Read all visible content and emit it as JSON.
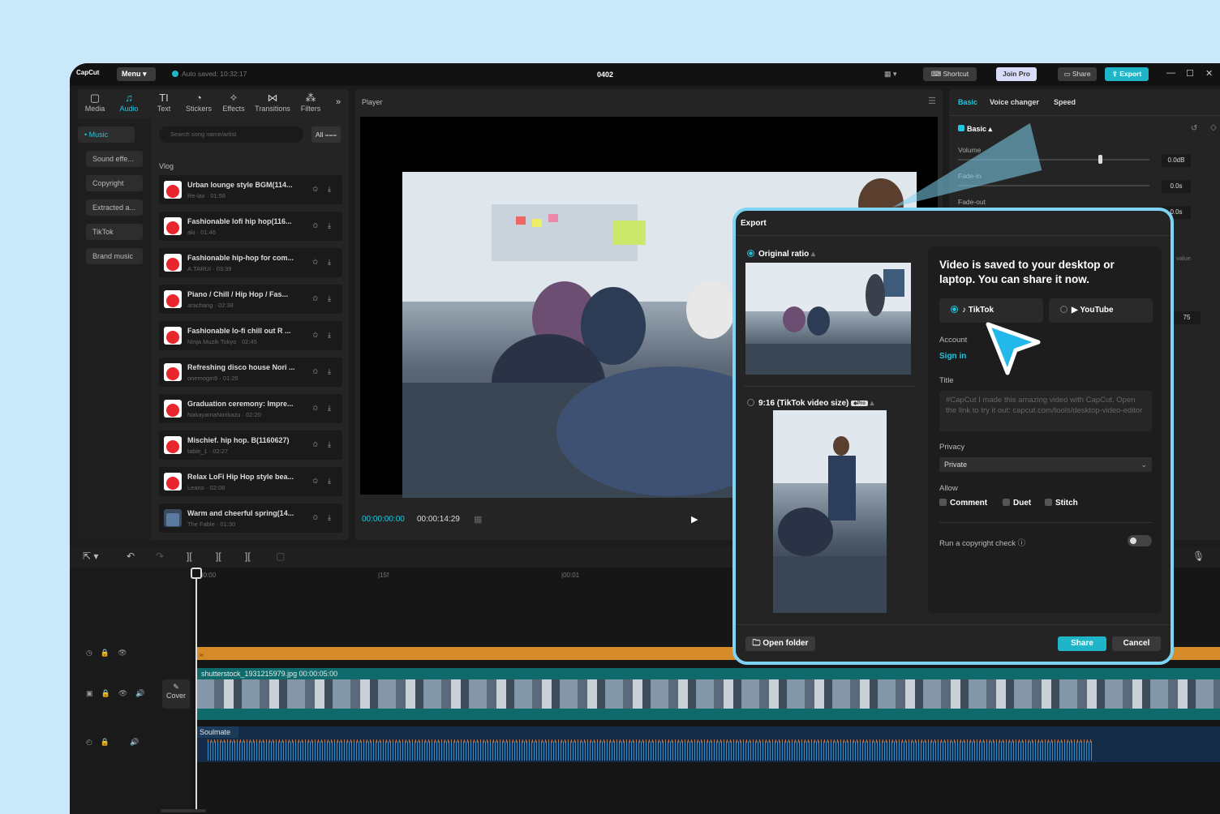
{
  "app": {
    "logo": "CapCut",
    "menu": "Menu",
    "auto_saved": "Auto saved: 10:32:17",
    "project": "0402",
    "shortcut": "Shortcut",
    "join_pro": "Join Pro",
    "share": "Share",
    "export": "Export"
  },
  "tools": [
    {
      "label": "Media",
      "icon": "▢"
    },
    {
      "label": "Audio",
      "icon": "♫"
    },
    {
      "label": "Text",
      "icon": "TI"
    },
    {
      "label": "Stickers",
      "icon": "◔"
    },
    {
      "label": "Effects",
      "icon": "✧"
    },
    {
      "label": "Transitions",
      "icon": "⋈"
    },
    {
      "label": "Filters",
      "icon": "⁂"
    }
  ],
  "sidebar": [
    "Music",
    "Sound effe...",
    "Copyright",
    "Extracted a...",
    "TikTok",
    "Brand music"
  ],
  "search": {
    "placeholder": "Search song name/artist",
    "all": "All"
  },
  "section": "Vlog",
  "tracks": [
    {
      "title": "Urban lounge style BGM(114...",
      "meta": "Re-lax · 01:58"
    },
    {
      "title": "Fashionable lofi hip hop(116...",
      "meta": "aki · 01:46"
    },
    {
      "title": "Fashionable hip-hop for com...",
      "meta": "A.TARUI · 03:39"
    },
    {
      "title": "Piano / Chill / Hip Hop / Fas...",
      "meta": "arachang · 02:38"
    },
    {
      "title": "Fashionable lo-fi chill out R ...",
      "meta": "Ninja Muzik Tokyo · 02:45"
    },
    {
      "title": "Refreshing disco house Nori ...",
      "meta": "onemogin9 · 01:26"
    },
    {
      "title": "Graduation ceremony: Impre...",
      "meta": "NakayamaNorikazu · 02:20"
    },
    {
      "title": "Mischief. hip hop. B(1160627)",
      "meta": "table_1 · 02:27"
    },
    {
      "title": "Relax LoFi Hip Hop style bea...",
      "meta": "Leano · 02:08"
    },
    {
      "title": "Warm and cheerful spring(14...",
      "meta": "The Fable · 01:30"
    }
  ],
  "player": {
    "label": "Player",
    "current": "00:00:00:00",
    "total": "00:00:14:29"
  },
  "right": {
    "tabs": [
      "Basic",
      "Voice changer",
      "Speed"
    ],
    "basic": "Basic",
    "volume": "Volume",
    "volume_val": "0.0dB",
    "fadein": "Fade-in",
    "fadein_val": "0.0s",
    "fadeout": "Fade-out",
    "fadeout_val": "0.0s",
    "value": "value",
    "num": "75"
  },
  "timeline": {
    "r0": "00:00",
    "r1": "15f",
    "r2": "00:01",
    "clip": "shutterstock_1931215979.jpg  00:00:05:00",
    "cover": "Cover",
    "audio": "Soulmate"
  },
  "export": {
    "title": "Export",
    "opt1": "Original ratio",
    "opt2": "9:16 (TikTok video size)",
    "message": "Video is saved to your desktop or laptop. You can share it now.",
    "tiktok": "TikTok",
    "youtube": "YouTube",
    "account": "Account",
    "signin": "Sign in",
    "title_lbl": "Title",
    "title_text": "#CapCut I made this amazing video with CapCut. Open the link to try it out: capcut.com/tools/desktop-video-editor",
    "privacy": "Privacy",
    "privacy_val": "Private",
    "allow": "Allow",
    "comment": "Comment",
    "duet": "Duet",
    "stitch": "Stitch",
    "copyright": "Run a copyright check",
    "open_folder": "Open folder",
    "share": "Share",
    "cancel": "Cancel"
  },
  "colors": {
    "accent": "#22c6e0",
    "highlight": "#7fd3f3"
  }
}
